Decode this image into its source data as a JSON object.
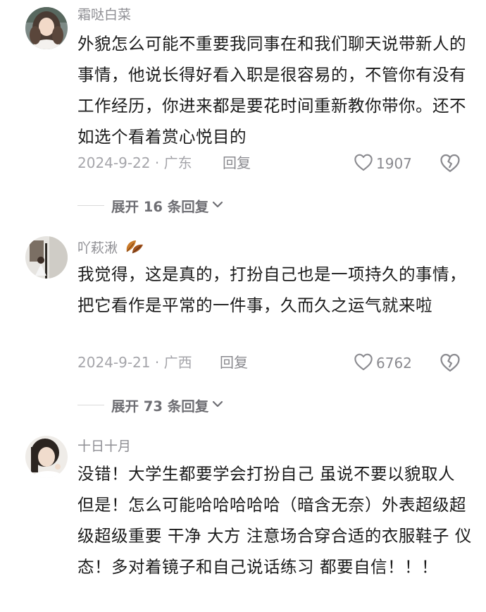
{
  "comments": [
    {
      "username": "霜哒白菜",
      "text": "外貌怎么可能不重要我同事在和我们聊天说带新人的事情，他说长得好看入职是很容易的，不管你有没有工作经历，你进来都是要花时间重新教你带你。还不如选个看着赏心悦目的",
      "date": "2024-9-22",
      "location": "广东",
      "meta": "2024-9-22 · 广东",
      "reply_label": "回复",
      "likes": "1907",
      "expand_label": "展开 16 条回复"
    },
    {
      "username": "吖萩湫",
      "username_emoji": "leaves-emoji",
      "text": "我觉得，这是真的，打扮自己也是一项持久的事情，把它看作是平常的一件事，久而久之运气就来啦",
      "date": "2024-9-21",
      "location": "广西",
      "meta": "2024-9-21 · 广西",
      "reply_label": "回复",
      "likes": "6762",
      "expand_label": "展开 73 条回复"
    },
    {
      "username": "十日十月",
      "text": "没错！大学生都要学会打扮自己 虽说不要以貌取人 但是！怎么可能哈哈哈哈哈（暗含无奈）外表超级超级超级重要 干净 大方 注意场合穿合适的衣服鞋子 仪态！多对着镜子和自己说话练习 都要自信！！！"
    }
  ],
  "icons": {
    "like": "heart-outline-icon",
    "dislike": "broken-heart-icon",
    "expand": "chevron-down-icon"
  }
}
